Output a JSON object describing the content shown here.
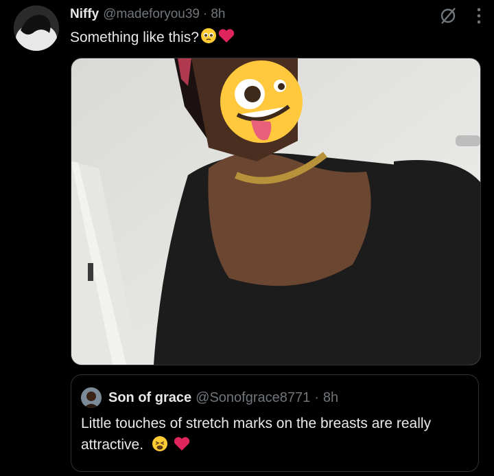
{
  "tweet": {
    "author_name": "Niffy",
    "author_handle": "@madeforyou39",
    "separator": "·",
    "time": "8h",
    "text": "Something like this?"
  },
  "emojis": {
    "tweet": [
      "pleading-face",
      "red-heart"
    ],
    "quote": [
      "tired-face",
      "red-heart"
    ],
    "overlay": "zany-face"
  },
  "quote": {
    "author_name": "Son of grace",
    "author_handle": "@Sonofgrace8771",
    "separator": "·",
    "time": "8h",
    "text": "Little touches of stretch marks on the breasts are really attractive."
  },
  "colors": {
    "background": "#000000",
    "text": "#e7e9ea",
    "muted": "#71767b",
    "border": "#2f3336",
    "heart": "#e0245e"
  }
}
